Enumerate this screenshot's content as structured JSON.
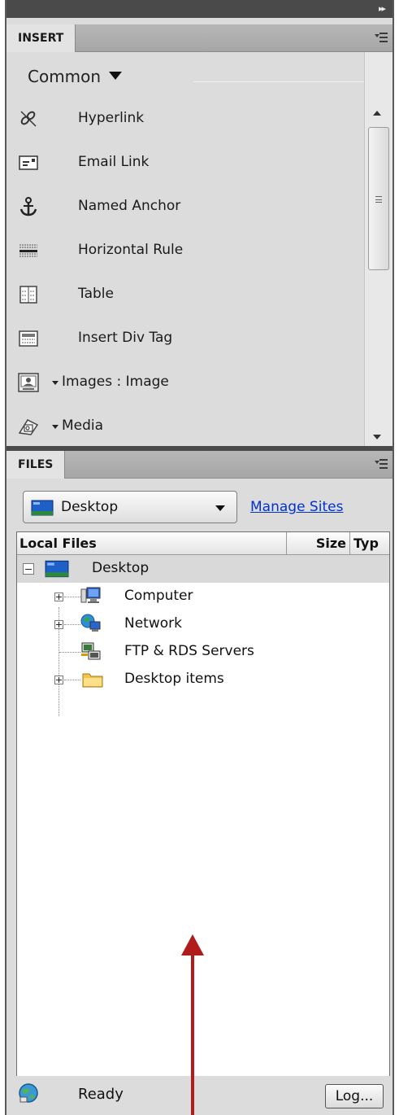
{
  "insert_panel": {
    "tab_label": "INSERT",
    "category": "Common",
    "items": [
      {
        "label": "Hyperlink",
        "icon": "hyperlink-icon"
      },
      {
        "label": "Email Link",
        "icon": "email-link-icon"
      },
      {
        "label": "Named Anchor",
        "icon": "named-anchor-icon"
      },
      {
        "label": "Horizontal Rule",
        "icon": "horizontal-rule-icon"
      },
      {
        "label": "Table",
        "icon": "table-icon"
      },
      {
        "label": "Insert Div Tag",
        "icon": "div-tag-icon"
      },
      {
        "label": "Images : Image",
        "icon": "image-icon",
        "has_dropdown": true
      },
      {
        "label": "Media",
        "icon": "media-icon",
        "has_dropdown": true
      }
    ]
  },
  "files_panel": {
    "tab_label": "FILES",
    "site_select": {
      "value": "Desktop"
    },
    "manage_sites_link": "Manage Sites",
    "columns": [
      "Local Files",
      "Size",
      "Typ"
    ],
    "tree": {
      "root": {
        "label": "Desktop",
        "icon": "desktop-monitor-icon",
        "expanded": true
      },
      "children": [
        {
          "label": "Computer",
          "icon": "computer-icon",
          "expandable": true
        },
        {
          "label": "Network",
          "icon": "network-icon",
          "expandable": true
        },
        {
          "label": "FTP & RDS Servers",
          "icon": "ftp-servers-icon",
          "expandable": false
        },
        {
          "label": "Desktop items",
          "icon": "folder-icon",
          "expandable": true
        }
      ]
    },
    "status": {
      "text": "Ready",
      "log_button": "Log..."
    }
  },
  "colors": {
    "panel_bg": "#dcdcdc",
    "dark_bar": "#4a4a4a",
    "link": "#0033cc",
    "annotation_arrow": "#b01c1c"
  }
}
